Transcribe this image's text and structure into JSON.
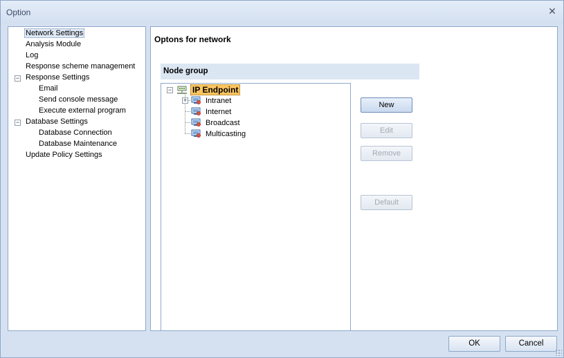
{
  "window": {
    "title": "Option"
  },
  "nav": {
    "items": [
      {
        "label": "Network Settings",
        "selected": true
      },
      {
        "label": "Analysis Module"
      },
      {
        "label": "Log"
      },
      {
        "label": "Response scheme management"
      },
      {
        "label": "Response Settings",
        "expander": "−"
      },
      {
        "label": "Email"
      },
      {
        "label": "Send console message"
      },
      {
        "label": "Execute external program"
      },
      {
        "label": "Database Settings",
        "expander": "−"
      },
      {
        "label": "Database Connection"
      },
      {
        "label": "Database Maintenance"
      },
      {
        "label": "Update Policy Settings"
      }
    ]
  },
  "content": {
    "title": "Optons for network",
    "group_header": "Node group",
    "tree": {
      "root": {
        "label": "IP Endpoint",
        "expander": "−"
      },
      "children": [
        {
          "label": "Intranet",
          "expander": "+"
        },
        {
          "label": "Internet"
        },
        {
          "label": "Broadcast"
        },
        {
          "label": "Multicasting"
        }
      ]
    },
    "buttons": {
      "new": "New",
      "edit": "Edit",
      "remove": "Remove",
      "default": "Default"
    }
  },
  "footer": {
    "ok": "OK",
    "cancel": "Cancel"
  },
  "colors": {
    "accent": "#fcc55f",
    "window_bg": "#d5e1f1",
    "border": "#8ea7c8"
  }
}
